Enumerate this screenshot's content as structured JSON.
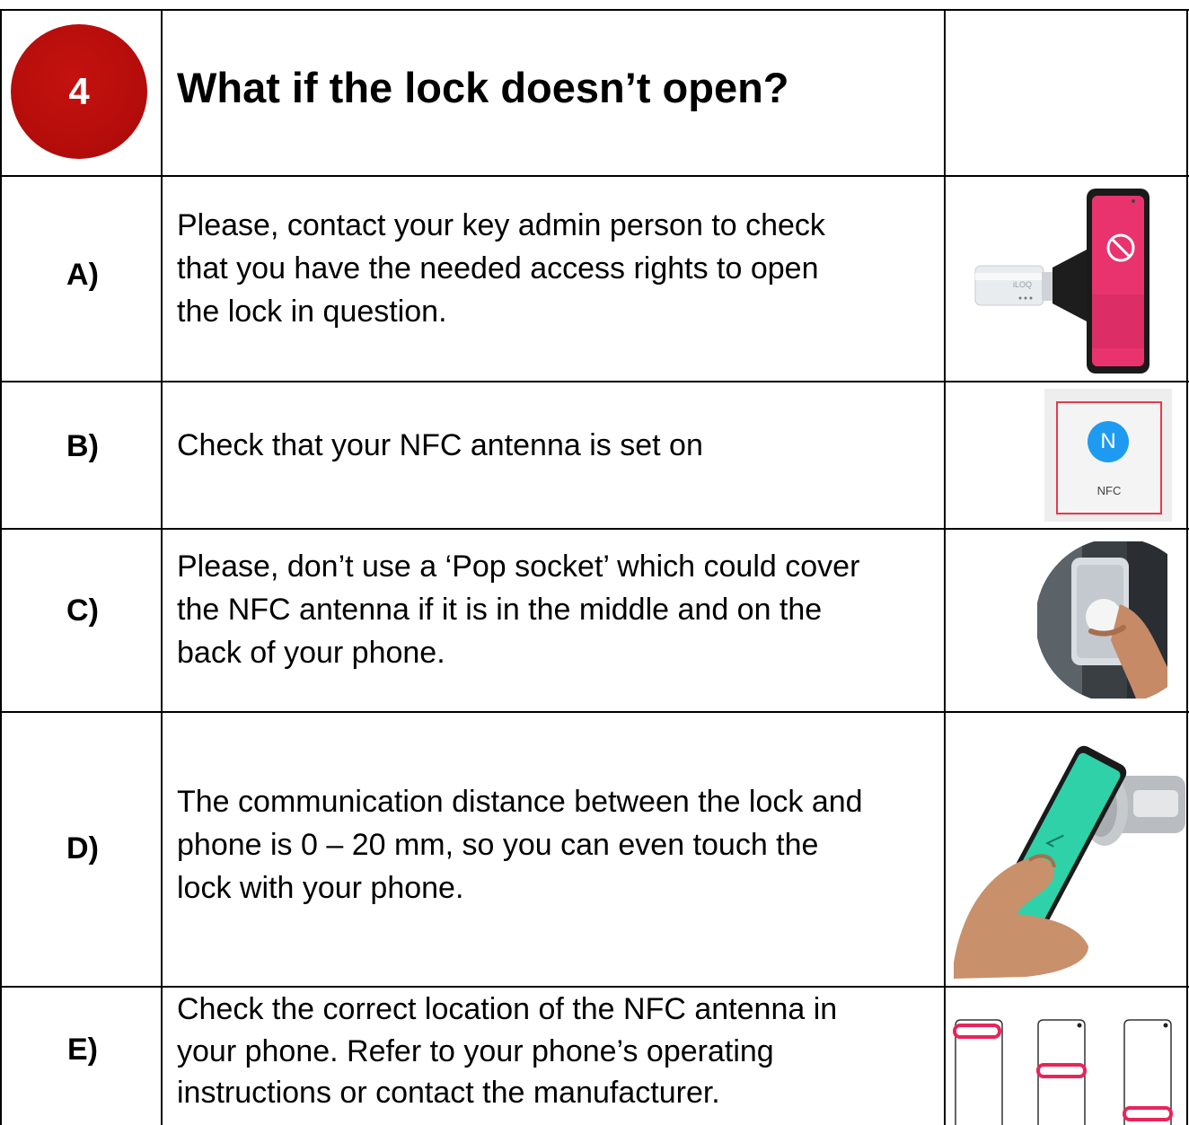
{
  "header": {
    "step_number": "4",
    "title": "What if the lock doesn’t open?"
  },
  "rows": [
    {
      "label": "A)",
      "lines": [
        "Please, contact your key admin person to check",
        "that you have the needed access rights to open",
        "the lock in question."
      ]
    },
    {
      "label": "B)",
      "lines": [
        "Check that your NFC antenna is set on"
      ]
    },
    {
      "label": "C)",
      "lines": [
        "Please, don’t use a ‘Pop socket’ which could cover",
        "the NFC antenna if it is in the middle and on the",
        "back of your phone."
      ]
    },
    {
      "label": "D)",
      "lines": [
        "The communication distance between the lock and",
        "phone is 0 – 20 mm, so you can even touch the",
        "lock with your phone."
      ]
    },
    {
      "label": "E)",
      "lines": [
        "Check the correct location of the NFC antenna in",
        "your phone. Refer to your phone’s operating",
        "instructions or contact the manufacturer."
      ]
    }
  ],
  "images": {
    "lock_brand": "iLOQ",
    "nfc_tile_label": "NFC",
    "nfc_glyph": "N"
  },
  "colors": {
    "badge_red": "#b50d0b",
    "nfc_blue": "#1e9bf0",
    "highlight_pink": "#e8245a",
    "phone_pink": "#e8336f",
    "phone_teal": "#2fd1a8"
  }
}
